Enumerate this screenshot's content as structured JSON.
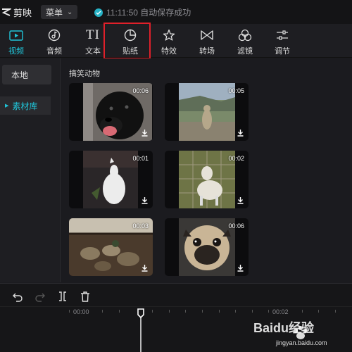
{
  "app": {
    "name": "剪映",
    "menu_label": "菜单",
    "save_status": "11:11:50 自动保存成功"
  },
  "toolbar": {
    "items": [
      {
        "label": "视频",
        "icon": "video-icon",
        "active": true
      },
      {
        "label": "音频",
        "icon": "music-icon",
        "active": false
      },
      {
        "label": "文本",
        "icon": "text-icon",
        "active": false
      },
      {
        "label": "贴纸",
        "icon": "sticker-icon",
        "active": false
      },
      {
        "label": "特效",
        "icon": "effects-icon",
        "active": false
      },
      {
        "label": "转场",
        "icon": "transition-icon",
        "active": false
      },
      {
        "label": "滤镜",
        "icon": "filter-icon",
        "active": false
      },
      {
        "label": "调节",
        "icon": "adjust-icon",
        "active": false
      }
    ],
    "accent_color": "#20c4d8",
    "highlight_color": "#e0202a"
  },
  "sidebar": {
    "local_label": "本地",
    "library_label": "素材库"
  },
  "content": {
    "section_title": "搞笑动物",
    "clips": [
      {
        "duration": "00:06",
        "subject": "black dog"
      },
      {
        "duration": "00:05",
        "subject": "meerkat"
      },
      {
        "duration": "00:01",
        "subject": "white bird"
      },
      {
        "duration": "00:02",
        "subject": "goat"
      },
      {
        "duration": "00:03",
        "subject": "ducks"
      },
      {
        "duration": "00:06",
        "subject": "pug"
      }
    ]
  },
  "timeline": {
    "ruler_labels": [
      "00:00",
      "00:02"
    ]
  },
  "watermark": {
    "brand": "Baidu经验",
    "url": "jingyan.baidu.com"
  }
}
